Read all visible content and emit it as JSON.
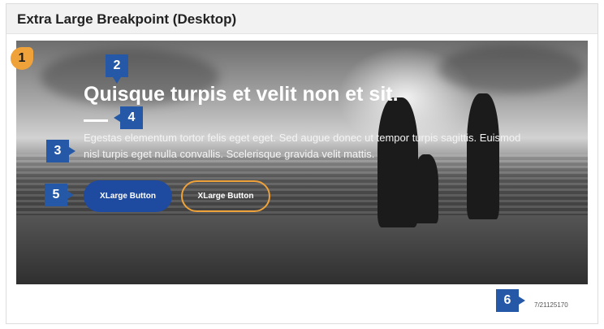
{
  "header": {
    "title": "Extra Large Breakpoint (Desktop)"
  },
  "hero": {
    "headline": "Quisque turpis et velit non et sit.",
    "body": "Egestas elementum tortor felis eget eget. Sed augue donec ut tempor turpis sagittis. Euismod nisl turpis eget nulla convallis. Scelerisque gravida velit mattis.",
    "primary_button": "XLarge Button",
    "secondary_button": "XLarge Button"
  },
  "markers": [
    "1",
    "2",
    "3",
    "4",
    "5",
    "6"
  ],
  "caption": "7/21125170",
  "colors": {
    "accent_blue": "#1e4aa0",
    "marker_blue": "#2559a8",
    "marker_orange": "#f0a23a"
  }
}
